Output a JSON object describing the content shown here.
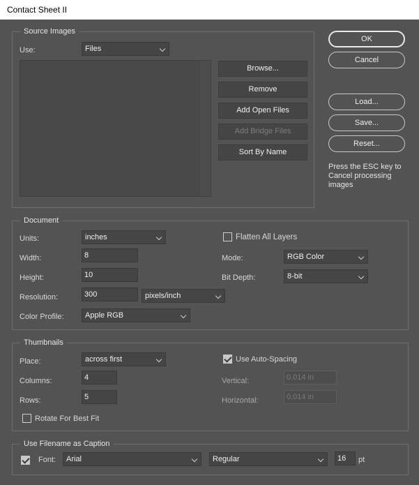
{
  "window": {
    "title": "Contact Sheet II"
  },
  "buttons": {
    "ok": "OK",
    "cancel": "Cancel",
    "load": "Load...",
    "save": "Save...",
    "reset": "Reset..."
  },
  "hint": "Press the ESC key to Cancel processing images",
  "source_images": {
    "legend": "Source Images",
    "use_label": "Use:",
    "use_value": "Files",
    "browse": "Browse...",
    "remove": "Remove",
    "add_open": "Add Open Files",
    "add_bridge": "Add Bridge Files",
    "sort": "Sort By Name"
  },
  "document": {
    "legend": "Document",
    "units_label": "Units:",
    "units_value": "inches",
    "width_label": "Width:",
    "width_value": "8",
    "height_label": "Height:",
    "height_value": "10",
    "resolution_label": "Resolution:",
    "resolution_value": "300",
    "resolution_unit": "pixels/inch",
    "profile_label": "Color Profile:",
    "profile_value": "Apple RGB",
    "flatten_label": "Flatten All Layers",
    "flatten_checked": false,
    "mode_label": "Mode:",
    "mode_value": "RGB Color",
    "bitdepth_label": "Bit Depth:",
    "bitdepth_value": "8-bit"
  },
  "thumbnails": {
    "legend": "Thumbnails",
    "place_label": "Place:",
    "place_value": "across first",
    "columns_label": "Columns:",
    "columns_value": "4",
    "rows_label": "Rows:",
    "rows_value": "5",
    "rotate_label": "Rotate For Best Fit",
    "rotate_checked": false,
    "autospacing_label": "Use Auto-Spacing",
    "autospacing_checked": true,
    "vertical_label": "Vertical:",
    "vertical_value": "0.014 in",
    "horizontal_label": "Horizontal:",
    "horizontal_value": "0.014 in"
  },
  "caption": {
    "legend": "Use Filename as Caption",
    "enabled": true,
    "font_label": "Font:",
    "font_value": "Arial",
    "style_value": "Regular",
    "size_value": "16",
    "size_unit": "pt"
  }
}
